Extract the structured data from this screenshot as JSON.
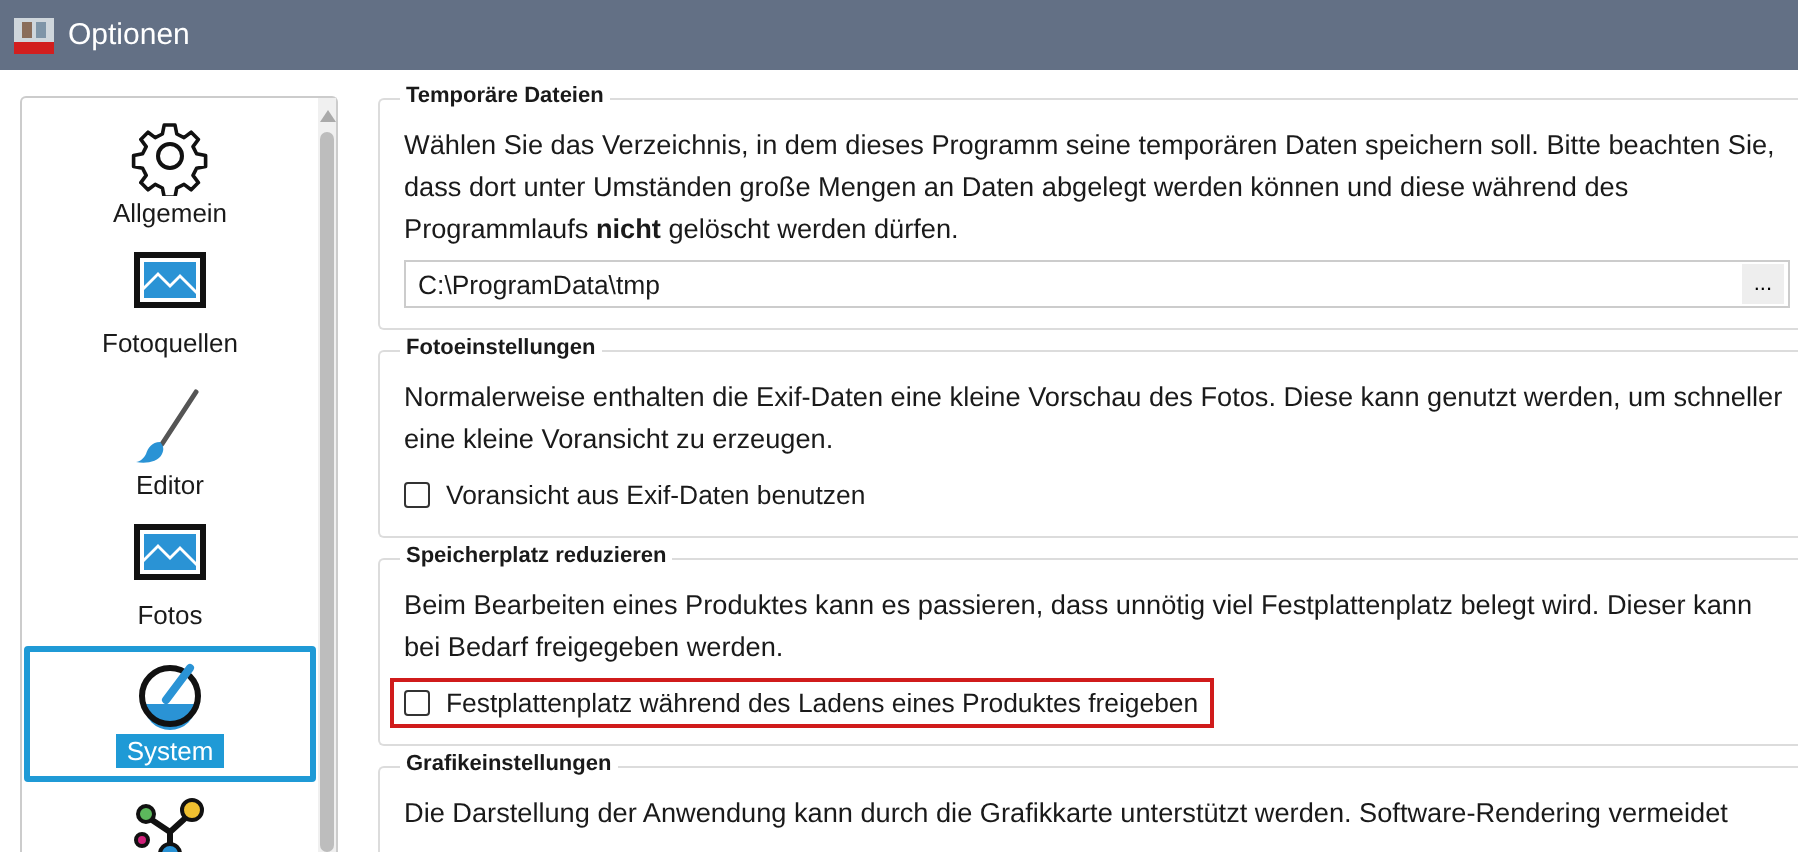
{
  "window": {
    "title": "Optionen"
  },
  "sidebar": {
    "items": [
      {
        "label": "Allgemein",
        "kind": "gear",
        "selected": false
      },
      {
        "label": "Fotoquellen",
        "kind": "image",
        "selected": false
      },
      {
        "label": "Editor",
        "kind": "brush",
        "selected": false
      },
      {
        "label": "Fotos",
        "kind": "image",
        "selected": false
      },
      {
        "label": "System",
        "kind": "gauge",
        "selected": true
      },
      {
        "kind": "nodes",
        "selected": false
      }
    ]
  },
  "sections": [
    {
      "title": "Temporäre Dateien",
      "items": [
        {
          "kind": "text",
          "text": "Wählen Sie das Verzeichnis, in dem dieses Programm seine temporären Daten speichern soll. Bitte beachten Sie, dass dort unter Umständen große Mengen an Daten abgelegt werden können und diese während des Programmlaufs **nicht** gelöscht werden dürfen."
        },
        {
          "kind": "path",
          "value": "C:\\ProgramData\\tmp",
          "button": "..."
        }
      ]
    },
    {
      "title": "Fotoeinstellungen",
      "items": [
        {
          "kind": "text",
          "text": "Normalerweise enthalten die Exif-Daten eine kleine Vorschau des Fotos. Diese kann genutzt werden, um schneller eine kleine Voransicht zu erzeugen."
        },
        {
          "kind": "checkbox",
          "label": "Voransicht aus Exif-Daten benutzen",
          "checked": false,
          "highlighted": false
        }
      ]
    },
    {
      "title": "Speicherplatz reduzieren",
      "items": [
        {
          "kind": "text",
          "text": "Beim Bearbeiten eines Produktes kann es passieren, dass unnötig viel Festplattenplatz belegt wird. Dieser kann bei Bedarf freigegeben werden."
        },
        {
          "kind": "checkbox",
          "label": "Festplattenplatz während des Ladens eines Produktes freigeben",
          "checked": false,
          "highlighted": true
        }
      ]
    },
    {
      "title": "Grafikeinstellungen",
      "items": [
        {
          "kind": "text",
          "text": "Die Darstellung der Anwendung kann durch die Grafikkarte unterstützt werden. Software-Rendering vermeidet"
        }
      ]
    }
  ]
}
